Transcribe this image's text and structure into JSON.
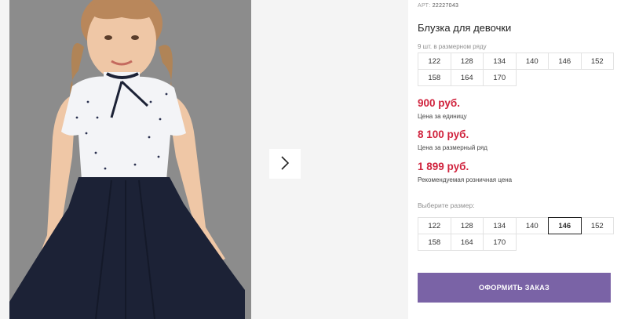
{
  "product": {
    "sku_label": "АРТ:",
    "sku_value": "22227043",
    "title": "Блузка для девочки",
    "size_note": "9 шт. в размерном ряду",
    "sizes_row": [
      "122",
      "128",
      "134",
      "140",
      "146",
      "152",
      "158",
      "164",
      "170"
    ]
  },
  "prices": {
    "unit_price": "900 руб.",
    "unit_label": "Цена за единицу",
    "row_price": "8 100 руб.",
    "row_label": "Цена за размерный ряд",
    "retail_price": "1 899 руб.",
    "retail_label": "Рекомендуемая розничная цена"
  },
  "size_select": {
    "label": "Выберите размер:",
    "options": [
      "122",
      "128",
      "134",
      "140",
      "146",
      "152",
      "158",
      "164",
      "170"
    ],
    "selected": "146"
  },
  "order_button": "ОФОРМИТЬ ЗАКАЗ",
  "gallery": {
    "next_icon": "chevron-right-icon"
  },
  "colors": {
    "price": "#d0233d",
    "button": "#7a63a6",
    "skirt": "#1c2236",
    "photo_bg": "#8e8e8e"
  }
}
